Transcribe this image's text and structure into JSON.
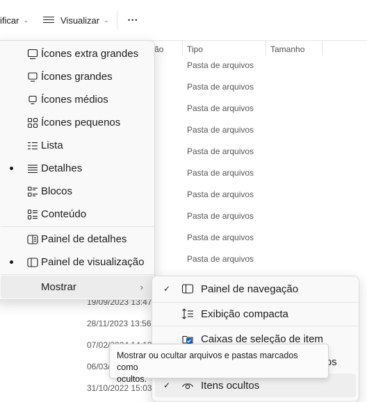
{
  "toolbar": {
    "sort_label": "ificar",
    "view_label": "Visualizar",
    "more_label": "•••"
  },
  "file_list": {
    "columns": [
      {
        "label": "ão"
      },
      {
        "label": "Tipo"
      },
      {
        "label": "Tamanho"
      }
    ],
    "types": [
      "Pasta de arquivos",
      "Pasta de arquivos",
      "Pasta de arquivos",
      "Pasta de arquivos",
      "Pasta de arquivos",
      "Pasta de arquivos",
      "Pasta de arquivos",
      "Pasta de arquivos",
      "Pasta de arquivos",
      "Pasta de arquivos"
    ],
    "dates": [
      "19/09/2023 13:47",
      "28/11/2023 13:56",
      "07/02/2024 14:13",
      "06/03/",
      "31/10/2022 15:03"
    ]
  },
  "view_menu": {
    "items": [
      {
        "label": "Ícones extra grandes",
        "icon": "monitor-icon",
        "selected": false
      },
      {
        "label": "Ícones grandes",
        "icon": "monitor-icon",
        "selected": false
      },
      {
        "label": "Ícones médios",
        "icon": "monitor-small-icon",
        "selected": false
      },
      {
        "label": "Ícones pequenos",
        "icon": "grid-icon",
        "selected": false
      },
      {
        "label": "Lista",
        "icon": "list-icon",
        "selected": false
      },
      {
        "label": "Detalhes",
        "icon": "details-icon",
        "selected": true
      },
      {
        "label": "Blocos",
        "icon": "tiles-icon",
        "selected": false
      },
      {
        "label": "Conteúdo",
        "icon": "content-icon",
        "selected": false
      }
    ],
    "panes": [
      {
        "label": "Painel de detalhes",
        "icon": "details-pane-icon",
        "selected": false
      },
      {
        "label": "Painel de visualização",
        "icon": "preview-pane-icon",
        "selected": true
      }
    ],
    "show": {
      "label": "Mostrar",
      "arrow": "›"
    }
  },
  "show_submenu": {
    "items": [
      {
        "label": "Painel de navegação",
        "checked": true,
        "icon": "navigation-pane-icon"
      },
      {
        "label": "Exibição compacta",
        "checked": false,
        "icon": "compact-view-icon"
      },
      {
        "label": "Caixas de seleção de item",
        "checked": false,
        "icon": "checkbox-icon"
      },
      {
        "label": "ivos",
        "checked": false,
        "icon": ""
      },
      {
        "label": "Itens ocultos",
        "checked": true,
        "icon": "eye-icon"
      }
    ],
    "check_glyph": "✓"
  },
  "tooltip": {
    "line1": "Mostrar ou ocultar arquivos e pastas marcados como",
    "line2": "ocultos."
  },
  "colors": {
    "accent": "#005fb8",
    "menu_bg": "#f9f9f9",
    "text": "#1b1b1b"
  }
}
